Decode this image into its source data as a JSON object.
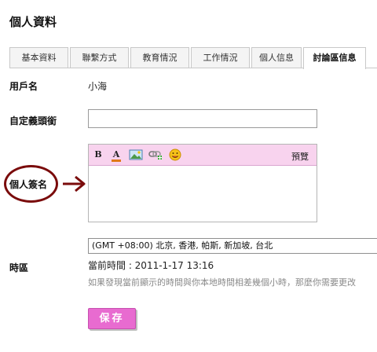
{
  "page_title": "個人資料",
  "tabs": [
    {
      "label": "基本資料",
      "active": false
    },
    {
      "label": "聯繫方式",
      "active": false
    },
    {
      "label": "教育情況",
      "active": false
    },
    {
      "label": "工作情況",
      "active": false
    },
    {
      "label": "個人信息",
      "active": false
    },
    {
      "label": "討論區信息",
      "active": true
    }
  ],
  "form": {
    "username": {
      "label": "用戶名",
      "value": "小海"
    },
    "custom_title": {
      "label": "自定義頭銜",
      "value": ""
    },
    "signature": {
      "label": "個人簽名",
      "value": "",
      "toolbar": {
        "bold_glyph": "B",
        "color_glyph": "A",
        "preview_label": "預覽",
        "icons": [
          "bold-icon",
          "font-color-icon",
          "image-icon",
          "link-icon",
          "smiley-icon"
        ]
      }
    },
    "timezone": {
      "label": "時區",
      "selected": "(GMT +08:00) 北京, 香港, 帕斯, 新加坡, 台北",
      "current_time": "當前時間 : 2011-1-17 13:16",
      "note": "如果發現當前顯示的時間與你本地時間相差幾個小時，那麼你需要更改"
    },
    "save_label": "保存"
  },
  "colors": {
    "toolbar_bg": "#f8d3ee",
    "save_button_bg": "#e86bd0",
    "annotation": "#7a0b0b"
  }
}
